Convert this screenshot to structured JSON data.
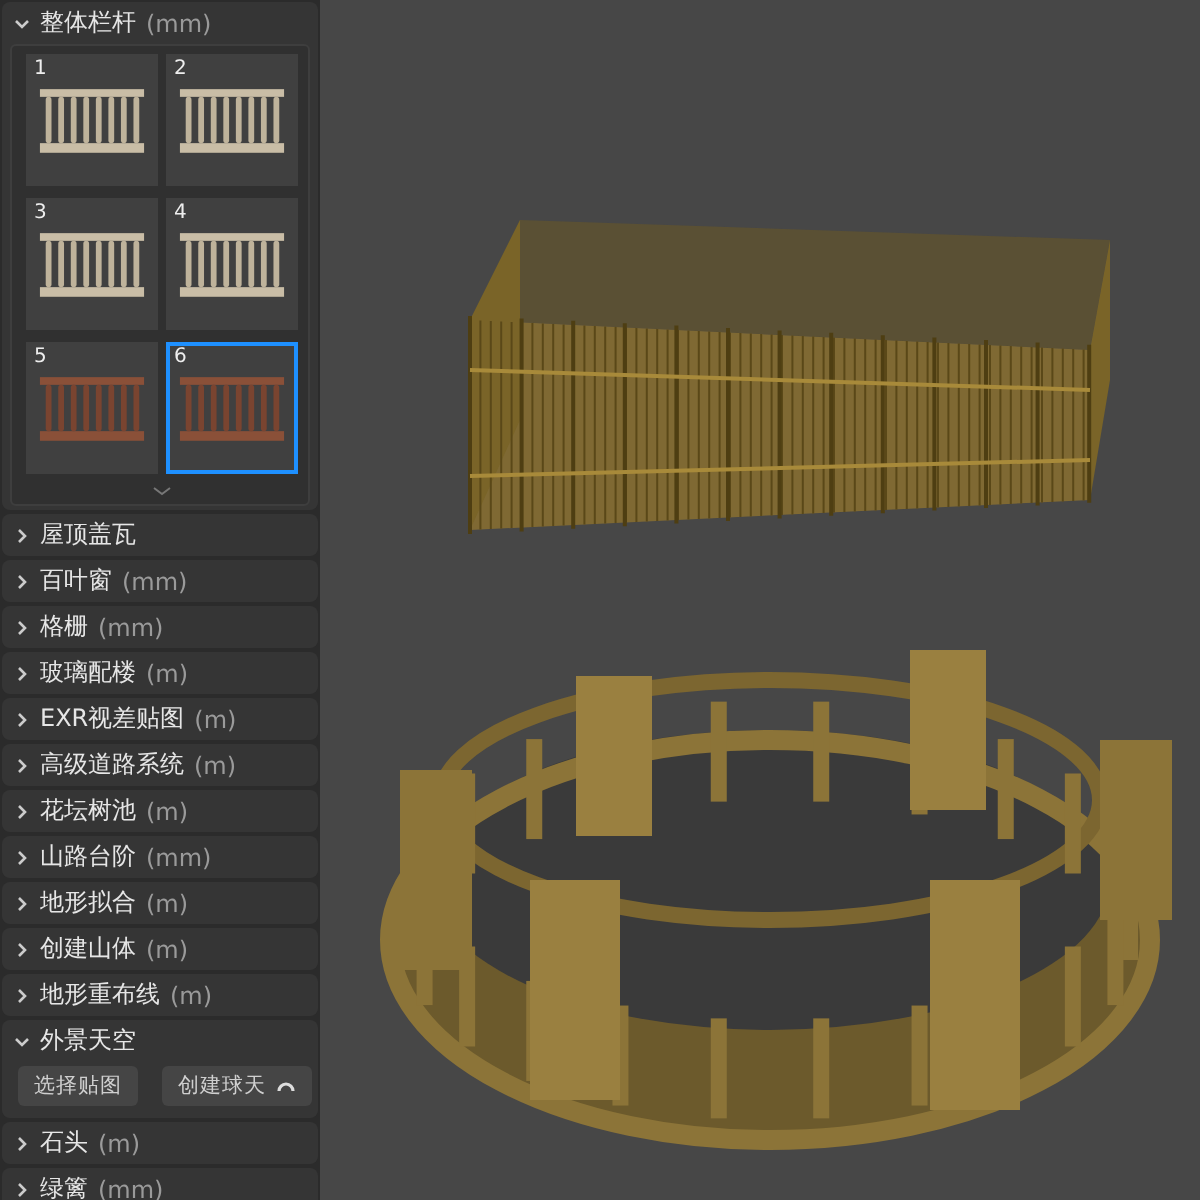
{
  "sections": [
    {
      "kind": "gallery",
      "title": "整体栏杆",
      "unit": "(mm)",
      "expanded": true,
      "thumbnails": [
        {
          "number": "1",
          "selected": false
        },
        {
          "number": "2",
          "selected": false
        },
        {
          "number": "3",
          "selected": false
        },
        {
          "number": "4",
          "selected": false
        },
        {
          "number": "5",
          "selected": false
        },
        {
          "number": "6",
          "selected": true
        }
      ]
    },
    {
      "title": "屋顶盖瓦",
      "expanded": false
    },
    {
      "title": "百叶窗",
      "unit": "(mm)",
      "expanded": false
    },
    {
      "title": "格栅",
      "unit": "(mm)",
      "expanded": false
    },
    {
      "title": "玻璃配楼",
      "unit": "(m)",
      "expanded": false
    },
    {
      "title": "EXR视差贴图",
      "unit": "(m)",
      "expanded": false
    },
    {
      "title": "高级道路系统",
      "unit": "(m)",
      "expanded": false
    },
    {
      "title": "花坛树池",
      "unit": "(m)",
      "expanded": false
    },
    {
      "title": "山路台阶",
      "unit": "(mm)",
      "expanded": false
    },
    {
      "title": "地形拟合",
      "unit": "(m)",
      "expanded": false
    },
    {
      "title": "创建山体",
      "unit": "(m)",
      "expanded": false
    },
    {
      "title": "地形重布线",
      "unit": "(m)",
      "expanded": false
    },
    {
      "kind": "buttons",
      "title": "外景天空",
      "expanded": true,
      "buttons": [
        "选择贴图",
        "创建球天"
      ]
    },
    {
      "title": "石头",
      "unit": "(m)",
      "expanded": false
    },
    {
      "title": "绿篱",
      "unit": "(mm)",
      "expanded": false
    }
  ]
}
